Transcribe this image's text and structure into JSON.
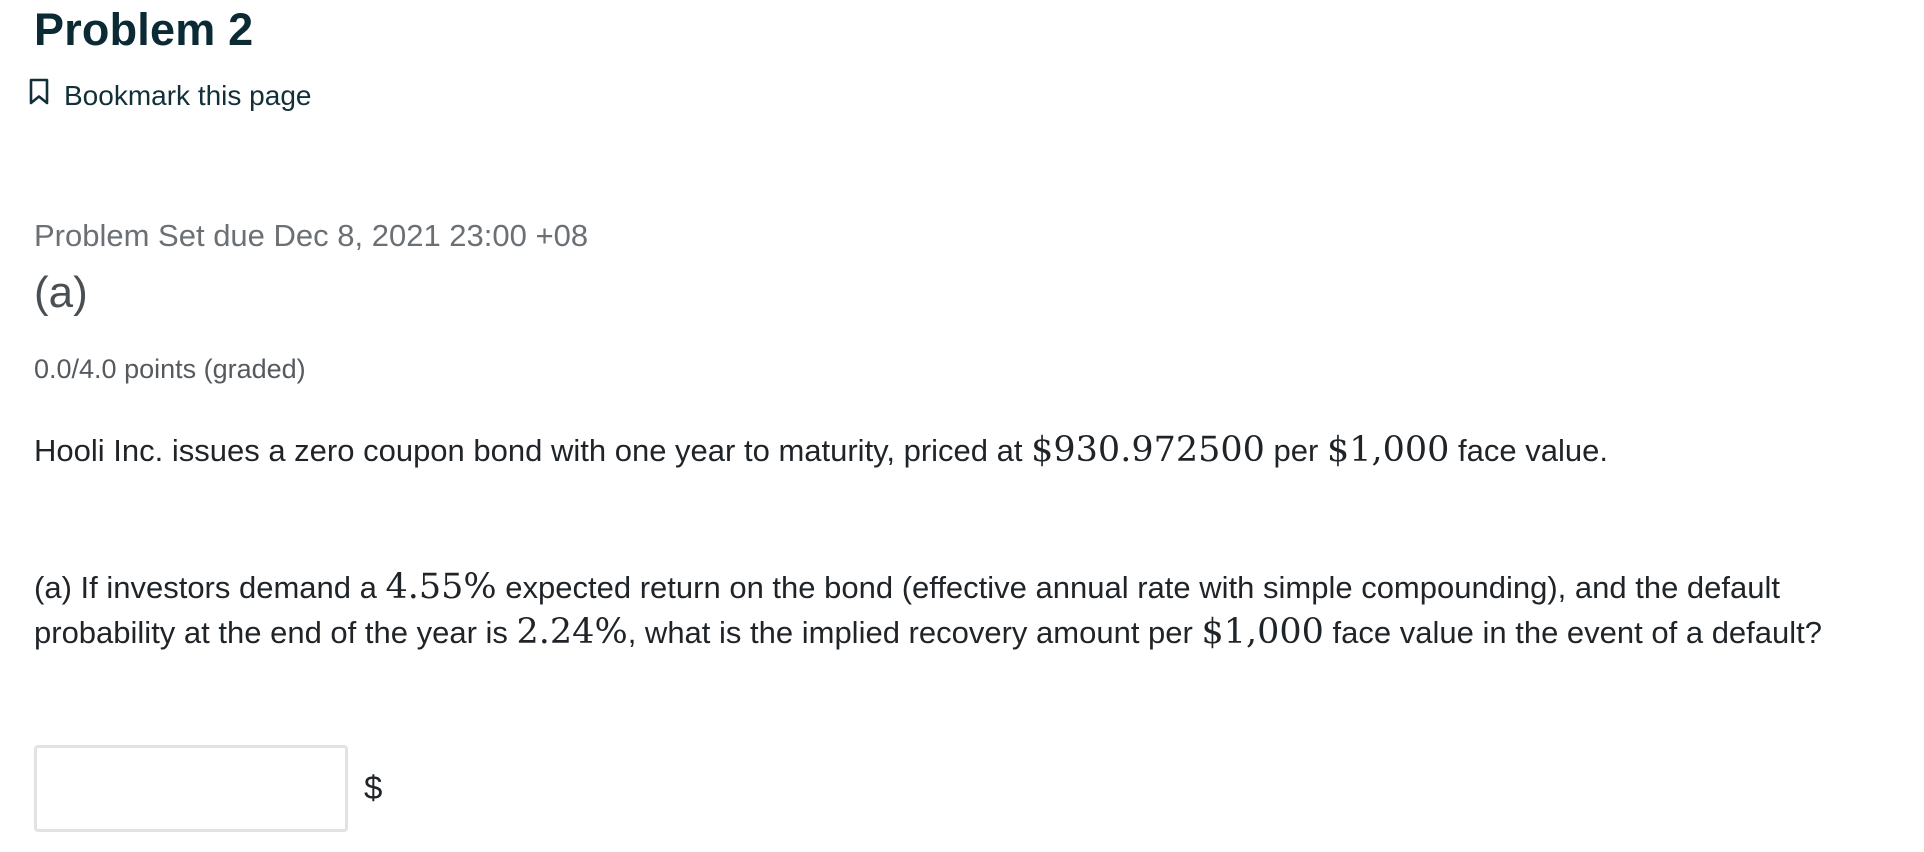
{
  "page": {
    "title": "Problem 2",
    "bookmark_label": "Bookmark this page",
    "bookmark_icon": "bookmark-icon"
  },
  "problem": {
    "due": "Problem Set due Dec 8, 2021 23:00 +08",
    "subtitle": "(a)",
    "points": "0.0/4.0 points (graded)",
    "intro": {
      "text1": "Hooli Inc. issues a zero coupon bond with one year to maturity, priced at ",
      "price": "$930.972500",
      "text2": " per ",
      "face": "$1,000",
      "text3": " face value."
    },
    "question": {
      "text1": "(a) If investors demand a ",
      "rate": "4.55%",
      "text2": " expected return on the bond (effective annual rate with simple compounding), and the default probability at the end of the year is ",
      "default_prob": "2.24%",
      "text3": ", what is the implied recovery amount per ",
      "face": "$1,000",
      "text4": " face value in the event of a default?"
    },
    "answer": {
      "value": "",
      "placeholder": "",
      "unit": "$"
    }
  }
}
